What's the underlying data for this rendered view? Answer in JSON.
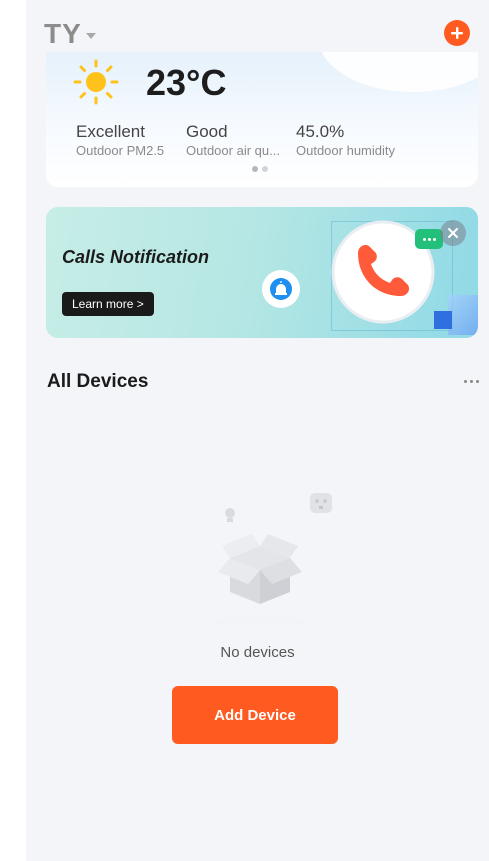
{
  "header": {
    "home_name": "TY"
  },
  "weather": {
    "temperature": "23°C",
    "stats": [
      {
        "value": "Excellent",
        "label": "Outdoor PM2.5"
      },
      {
        "value": "Good",
        "label": "Outdoor air qu..."
      },
      {
        "value": "45.0%",
        "label": "Outdoor humidity"
      }
    ]
  },
  "banner": {
    "title": "Calls Notification",
    "button_label": "Learn more >"
  },
  "devices": {
    "title": "All Devices",
    "empty_text": "No devices",
    "add_button_label": "Add Device"
  },
  "colors": {
    "accent": "#ff5a1f",
    "background": "#f4f5f8"
  },
  "icons": [
    "caret-down-icon",
    "add-icon",
    "sun-icon",
    "siren-icon",
    "phone-icon",
    "chat-icon",
    "close-icon",
    "more-icon",
    "empty-box-icon",
    "bulb-icon",
    "plug-icon"
  ]
}
